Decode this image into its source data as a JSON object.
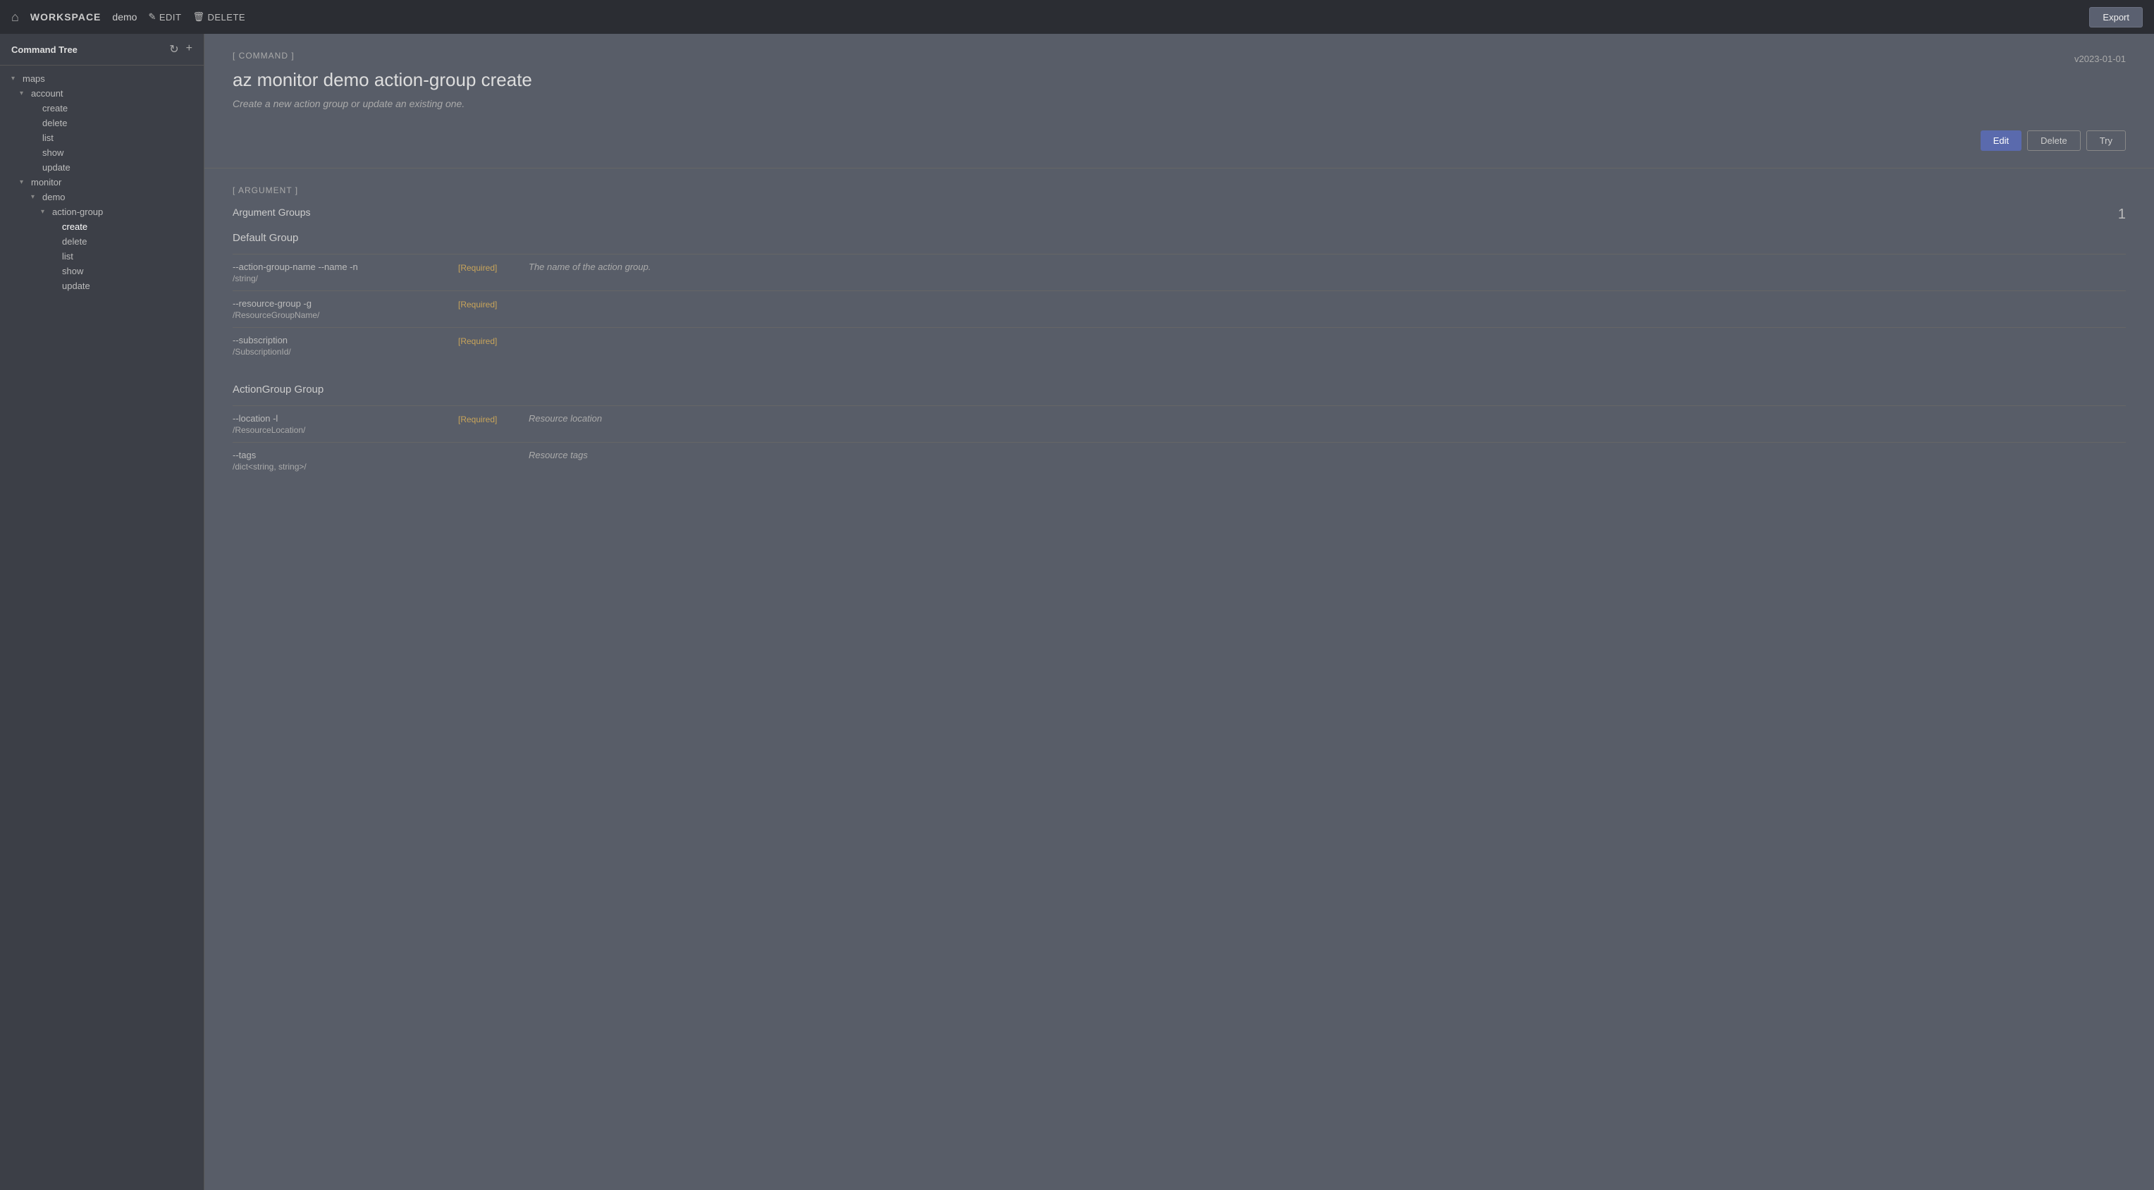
{
  "topbar": {
    "workspace_label": "WORKSPACE",
    "demo_label": "demo",
    "edit_label": "EDIT",
    "delete_label": "DELETE",
    "export_label": "Export"
  },
  "sidebar": {
    "title": "Command Tree",
    "tree": [
      {
        "id": "maps",
        "label": "maps",
        "level": 0,
        "expanded": true,
        "arrow": "▾"
      },
      {
        "id": "account",
        "label": "account",
        "level": 1,
        "expanded": true,
        "arrow": "▾"
      },
      {
        "id": "account-create",
        "label": "create",
        "level": 2,
        "expanded": false,
        "arrow": ""
      },
      {
        "id": "account-delete",
        "label": "delete",
        "level": 2,
        "expanded": false,
        "arrow": ""
      },
      {
        "id": "account-list",
        "label": "list",
        "level": 2,
        "expanded": false,
        "arrow": ""
      },
      {
        "id": "account-show",
        "label": "show",
        "level": 2,
        "expanded": false,
        "arrow": ""
      },
      {
        "id": "account-update",
        "label": "update",
        "level": 2,
        "expanded": false,
        "arrow": ""
      },
      {
        "id": "monitor",
        "label": "monitor",
        "level": 1,
        "expanded": true,
        "arrow": "▾"
      },
      {
        "id": "demo",
        "label": "demo",
        "level": 2,
        "expanded": true,
        "arrow": "▾"
      },
      {
        "id": "action-group",
        "label": "action-group",
        "level": 3,
        "expanded": true,
        "arrow": "▾"
      },
      {
        "id": "action-group-create",
        "label": "create",
        "level": 4,
        "expanded": false,
        "arrow": ""
      },
      {
        "id": "action-group-delete",
        "label": "delete",
        "level": 4,
        "expanded": false,
        "arrow": ""
      },
      {
        "id": "action-group-list",
        "label": "list",
        "level": 4,
        "expanded": false,
        "arrow": ""
      },
      {
        "id": "action-group-show",
        "label": "show",
        "level": 4,
        "expanded": false,
        "arrow": ""
      },
      {
        "id": "action-group-update",
        "label": "update",
        "level": 4,
        "expanded": false,
        "arrow": ""
      }
    ]
  },
  "command": {
    "tag": "[ COMMAND ]",
    "heading": "az monitor demo action-group create",
    "description": "Create a new action group or update an existing one.",
    "version": "v2023-01-01",
    "edit_label": "Edit",
    "delete_label": "Delete",
    "try_label": "Try"
  },
  "arguments": {
    "tag": "[ ARGUMENT ]",
    "groups_label": "Argument Groups",
    "count": "1",
    "groups": [
      {
        "name": "Default Group",
        "args": [
          {
            "name": "--action-group-name --name -n",
            "type": "/string/",
            "required": "[Required]",
            "description": "The name of the action group."
          },
          {
            "name": "--resource-group -g",
            "type": "/ResourceGroupName/",
            "required": "[Required]",
            "description": ""
          },
          {
            "name": "--subscription",
            "type": "/SubscriptionId/",
            "required": "[Required]",
            "description": ""
          }
        ]
      },
      {
        "name": "ActionGroup Group",
        "args": [
          {
            "name": "--location -l",
            "type": "/ResourceLocation/",
            "required": "[Required]",
            "description": "Resource location"
          },
          {
            "name": "--tags",
            "type": "/dict<string, string>/",
            "required": "",
            "description": "Resource tags"
          }
        ]
      }
    ]
  }
}
